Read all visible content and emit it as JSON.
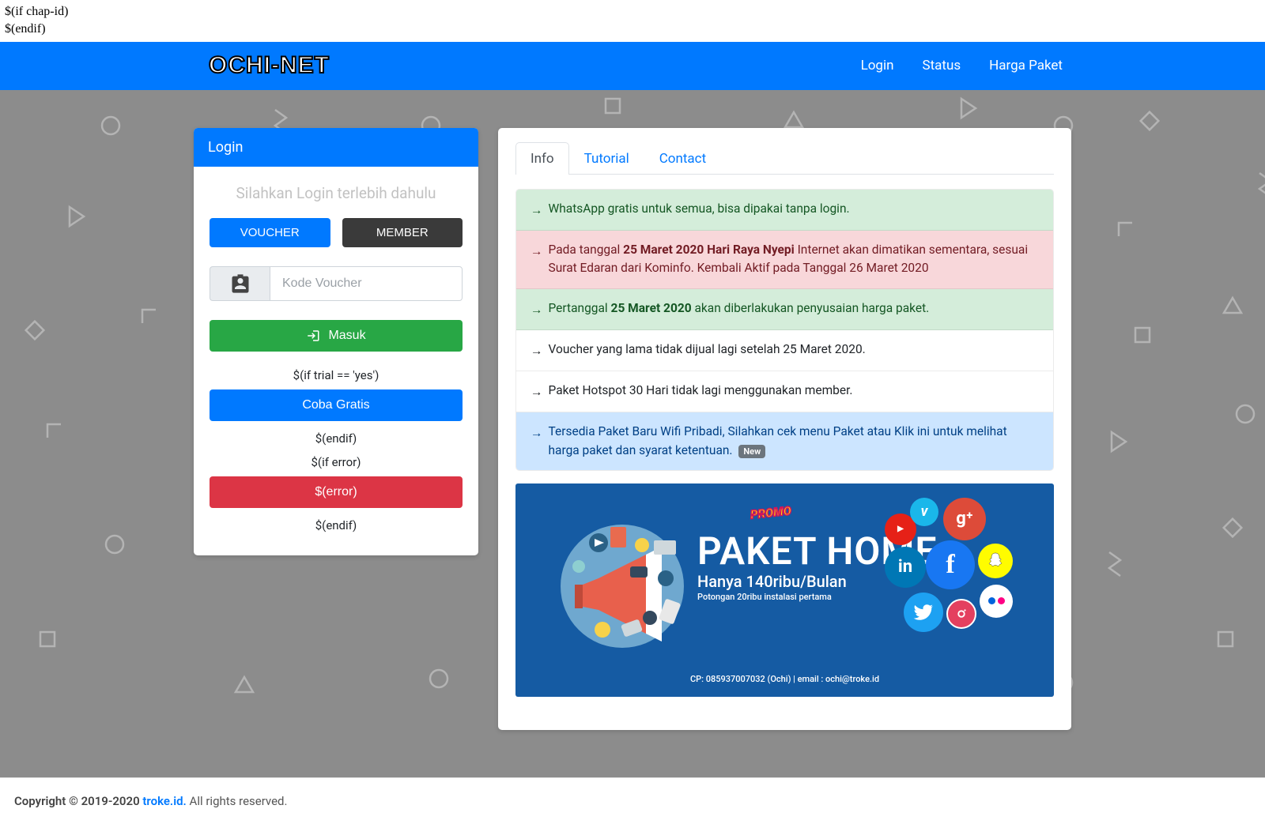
{
  "pre": {
    "line1": "$(if chap-id)",
    "line2": "$(endif)"
  },
  "brand": "OCHI-NET",
  "nav": {
    "login": "Login",
    "status": "Status",
    "paket": "Harga Paket"
  },
  "login_panel": {
    "heading": "Login",
    "prompt": "Silahkan Login terlebih dahulu",
    "tab_voucher": "VOUCHER",
    "tab_member": "MEMBER",
    "input_placeholder": "Kode Voucher",
    "btn_masuk": "Masuk",
    "txt_if_trial": "$(if trial == 'yes')",
    "btn_coba": "Coba Gratis",
    "txt_endif1": "$(endif)",
    "txt_if_error": "$(if error)",
    "btn_error": "$(error)",
    "txt_endif2": "$(endif)"
  },
  "tabs": {
    "info": "Info",
    "tutorial": "Tutorial",
    "contact": "Contact"
  },
  "info_items": [
    {
      "style": "success",
      "html": "WhatsApp gratis untuk semua, bisa dipakai tanpa login."
    },
    {
      "style": "danger",
      "html": "Pada tanggal <b>25 Maret 2020 Hari Raya Nyepi</b> Internet akan dimatikan sementara, sesuai Surat Edaran dari Kominfo. Kembali Aktif pada Tanggal 26 Maret 2020"
    },
    {
      "style": "success",
      "html": "Pertanggal <b>25 Maret 2020</b> akan diberlakukan penyusaian harga paket."
    },
    {
      "style": "default",
      "html": "Voucher yang lama tidak dijual lagi setelah 25 Maret 2020."
    },
    {
      "style": "default",
      "html": "Paket Hotspot 30 Hari tidak lagi menggunakan member."
    },
    {
      "style": "primary",
      "html": "Tersedia Paket Baru Wifi Pribadi, Silahkan cek menu Paket atau Klik ini untuk melihat harga paket dan syarat ketentuan. ",
      "badge": "New"
    }
  ],
  "promo": {
    "badge": "PROMO",
    "title": "PAKET HOME",
    "sub": "Hanya 140ribu/Bulan",
    "small": "Potongan 20ribu instalasi pertama",
    "contact": "CP: 085937007032 (Ochi)  |  email : ochi@troke.id"
  },
  "footer": {
    "copyright": "Copyright © 2019-2020 ",
    "link": "troke.id.",
    "rights": " All rights reserved."
  }
}
